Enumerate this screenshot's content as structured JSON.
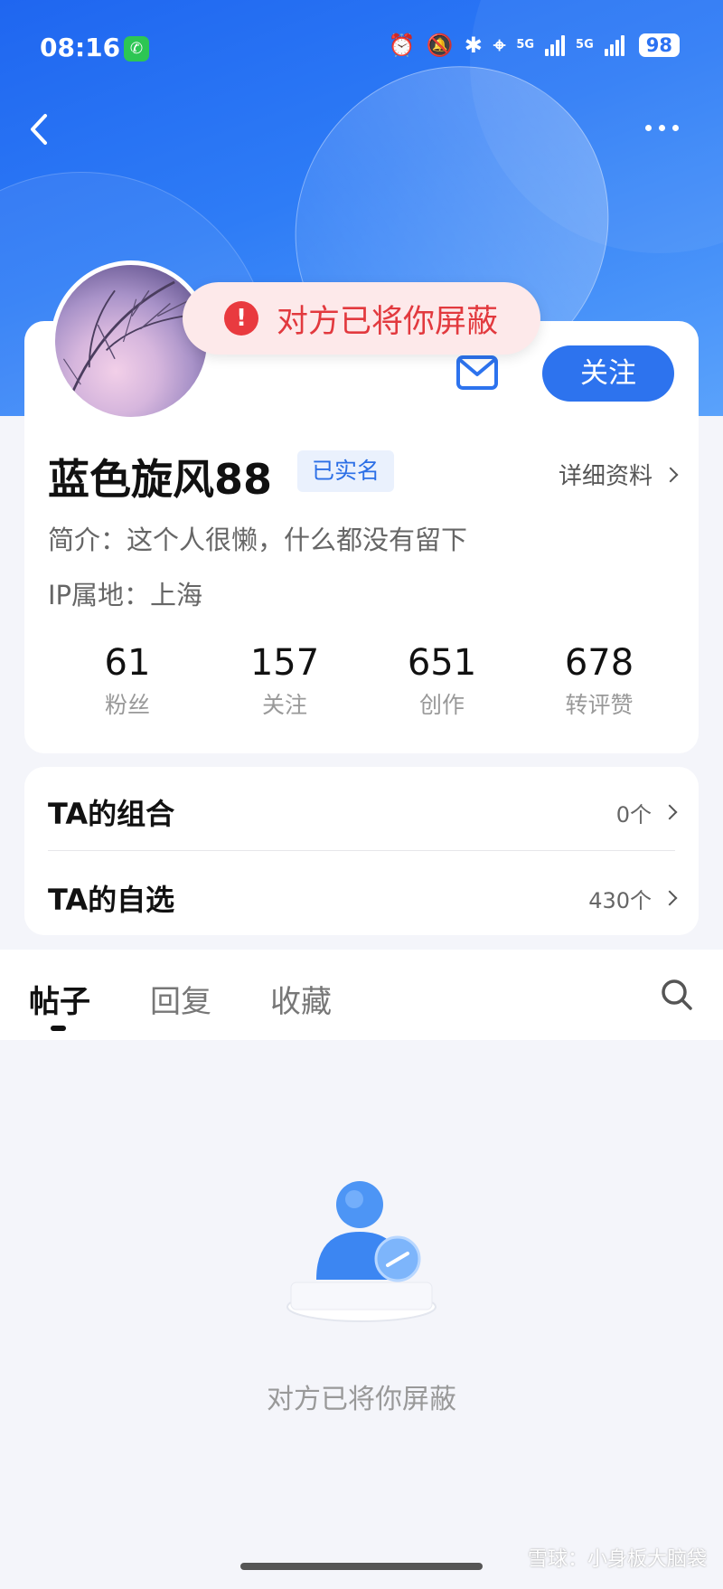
{
  "status_bar": {
    "time": "08:16",
    "network1": "5G",
    "network2": "5G",
    "battery": "98"
  },
  "toast": {
    "message": "对方已将你屏蔽"
  },
  "profile": {
    "follow_label": "关注",
    "username": "蓝色旋风88",
    "verified_badge": "已实名",
    "detail_link": "详细资料",
    "bio": "简介：这个人很懒，什么都没有留下",
    "ip": "IP属地：上海",
    "stats": [
      {
        "value": "61",
        "label": "粉丝"
      },
      {
        "value": "157",
        "label": "关注"
      },
      {
        "value": "651",
        "label": "创作"
      },
      {
        "value": "678",
        "label": "转评赞"
      }
    ]
  },
  "lists": {
    "portfolio_label": "TA的组合",
    "portfolio_value": "0个",
    "watchlist_label": "TA的自选",
    "watchlist_value": "430个"
  },
  "tabs": [
    {
      "label": "帖子",
      "active": true
    },
    {
      "label": "回复",
      "active": false
    },
    {
      "label": "收藏",
      "active": false
    }
  ],
  "empty_state": {
    "message": "对方已将你屏蔽"
  },
  "watermark": "雪球：小身板大脑袋",
  "colors": {
    "accent": "#2d73ee",
    "error": "#e93a3f"
  }
}
